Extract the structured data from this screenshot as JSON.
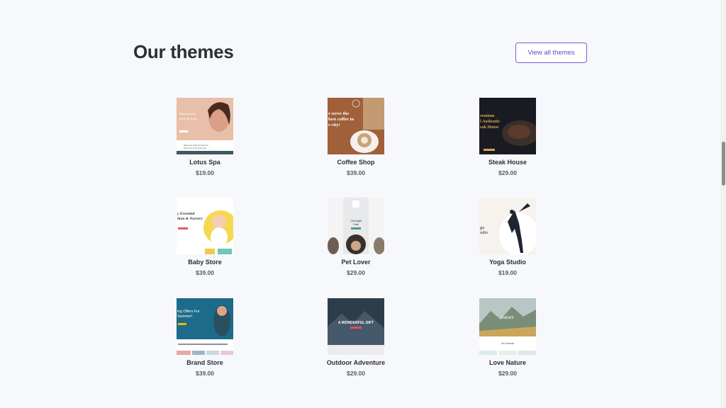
{
  "section": {
    "title": "Our themes",
    "view_all_label": "View all themes"
  },
  "themes": [
    {
      "name": "Lotus Spa",
      "price": "$19.00",
      "thumb_text": [
        "Rejuvenated",
        "Body & Soul",
        "Make your body and mind one",
        "with a time in the Lotus Spa"
      ]
    },
    {
      "name": "Coffee Shop",
      "price": "$39.00",
      "thumb_text": [
        "e serve the",
        "hest coffee in",
        "e city!"
      ]
    },
    {
      "name": "Steak House",
      "price": "$29.00",
      "thumb_text": [
        "remium",
        "l Authentic",
        "eak House"
      ]
    },
    {
      "name": "Baby Store",
      "price": "$39.00",
      "thumb_text": [
        "y Essential",
        "hion & Nursery"
      ]
    },
    {
      "name": "Pet Lover",
      "price": "$29.00",
      "thumb_text": [
        "Overnight",
        "Care"
      ]
    },
    {
      "name": "Yoga Studio",
      "price": "$19.00",
      "thumb_text": [
        "ga",
        "udio"
      ]
    },
    {
      "name": "Brand Store",
      "price": "$39.00",
      "thumb_text": [
        "ing Offers For",
        "Summer!"
      ]
    },
    {
      "name": "Outdoor Adventure",
      "price": "$29.00",
      "thumb_text": [
        "A WONDERFUL GIFT"
      ]
    },
    {
      "name": "Love Nature",
      "price": "$29.00",
      "thumb_text": [
        "nature",
        "Our Services"
      ]
    }
  ],
  "colors": {
    "accent": "#5a4fcf",
    "background": "#f7f8fb",
    "heading": "#2b2f36"
  }
}
